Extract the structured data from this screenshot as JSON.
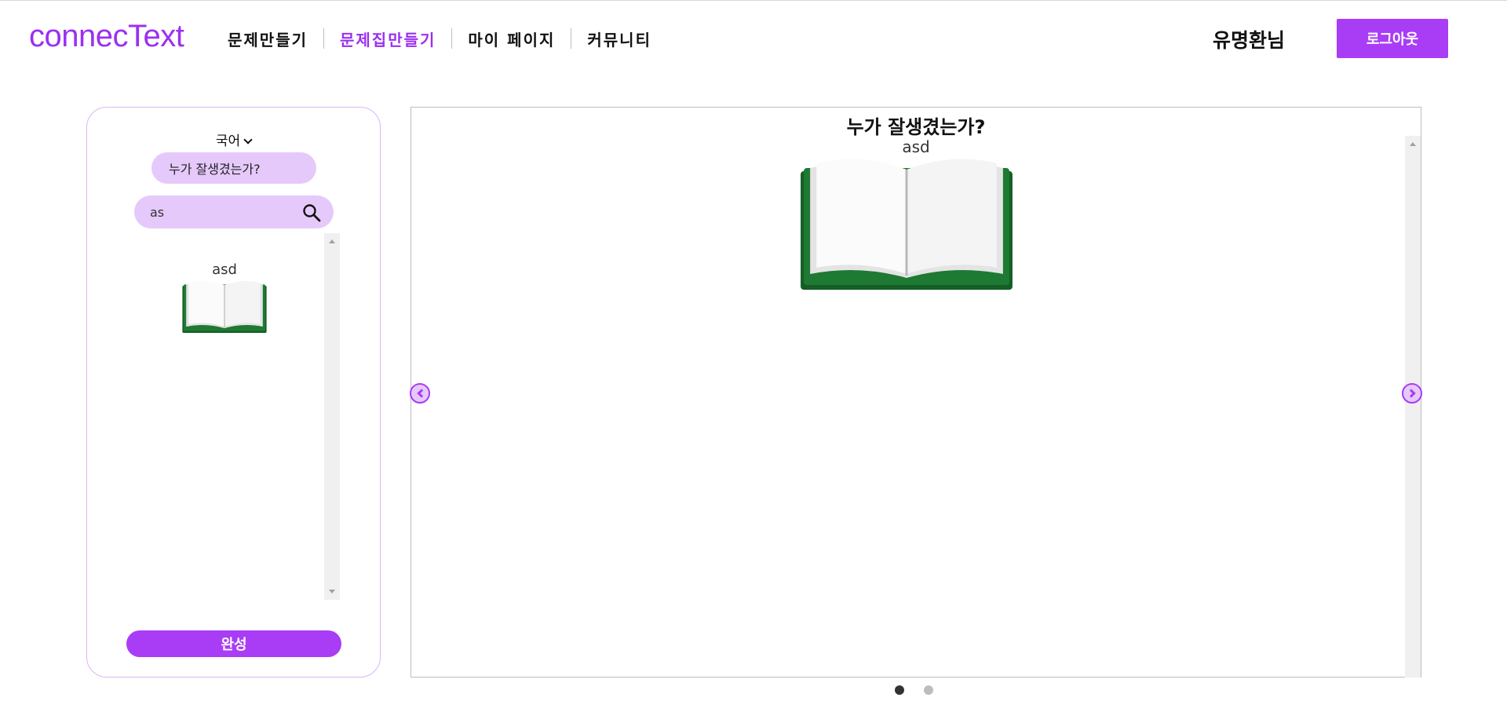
{
  "header": {
    "logo": "connecText",
    "nav": [
      {
        "label": "문제만들기",
        "active": false
      },
      {
        "label": "문제집만들기",
        "active": true
      },
      {
        "label": "마이 페이지",
        "active": false
      },
      {
        "label": "커뮤니티",
        "active": false
      }
    ],
    "user_name": "유명환님",
    "logout_label": "로그아웃"
  },
  "sidebar": {
    "subject": "국어",
    "workbook_title": "누가 잘생겼는가?",
    "search": {
      "value": "as",
      "icon": "search-icon"
    },
    "items": [
      {
        "label": "asd",
        "icon": "book-icon"
      }
    ],
    "done_label": "완성"
  },
  "preview": {
    "title": "누가 잘생겼는가?",
    "item_label": "asd",
    "item_icon": "book-icon",
    "page_count": 2,
    "current_page": 1
  },
  "colors": {
    "accent": "#a93cf5",
    "accent_light": "#e6c9fb",
    "book_cover": "#1e7a32"
  }
}
